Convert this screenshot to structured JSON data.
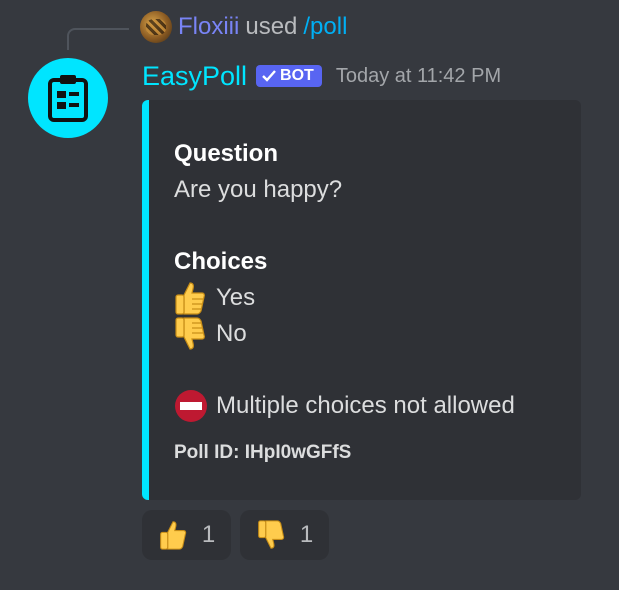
{
  "reply": {
    "username": "Floxiii",
    "used_text": "used",
    "command": "/poll",
    "avatar_icon": "cat-avatar-icon"
  },
  "message": {
    "author": "EasyPoll",
    "author_color": "#00e5ff",
    "badge_label": "BOT",
    "timestamp": "Today at 11:42 PM",
    "avatar_icon": "clipboard-icon"
  },
  "embed": {
    "accent_color": "#00e5ff",
    "question_title": "Question",
    "question_text": "Are you happy?",
    "choices_title": "Choices",
    "choices": [
      {
        "icon": "thumbs-up-icon",
        "label": "Yes"
      },
      {
        "icon": "thumbs-down-icon",
        "label": "No"
      }
    ],
    "note_icon": "no-entry-icon",
    "note_text": "Multiple choices not allowed",
    "footer": "Poll ID: IHpI0wGFfS"
  },
  "reactions": [
    {
      "icon": "thumbs-up-icon",
      "count": "1"
    },
    {
      "icon": "thumbs-down-icon",
      "count": "1"
    }
  ]
}
